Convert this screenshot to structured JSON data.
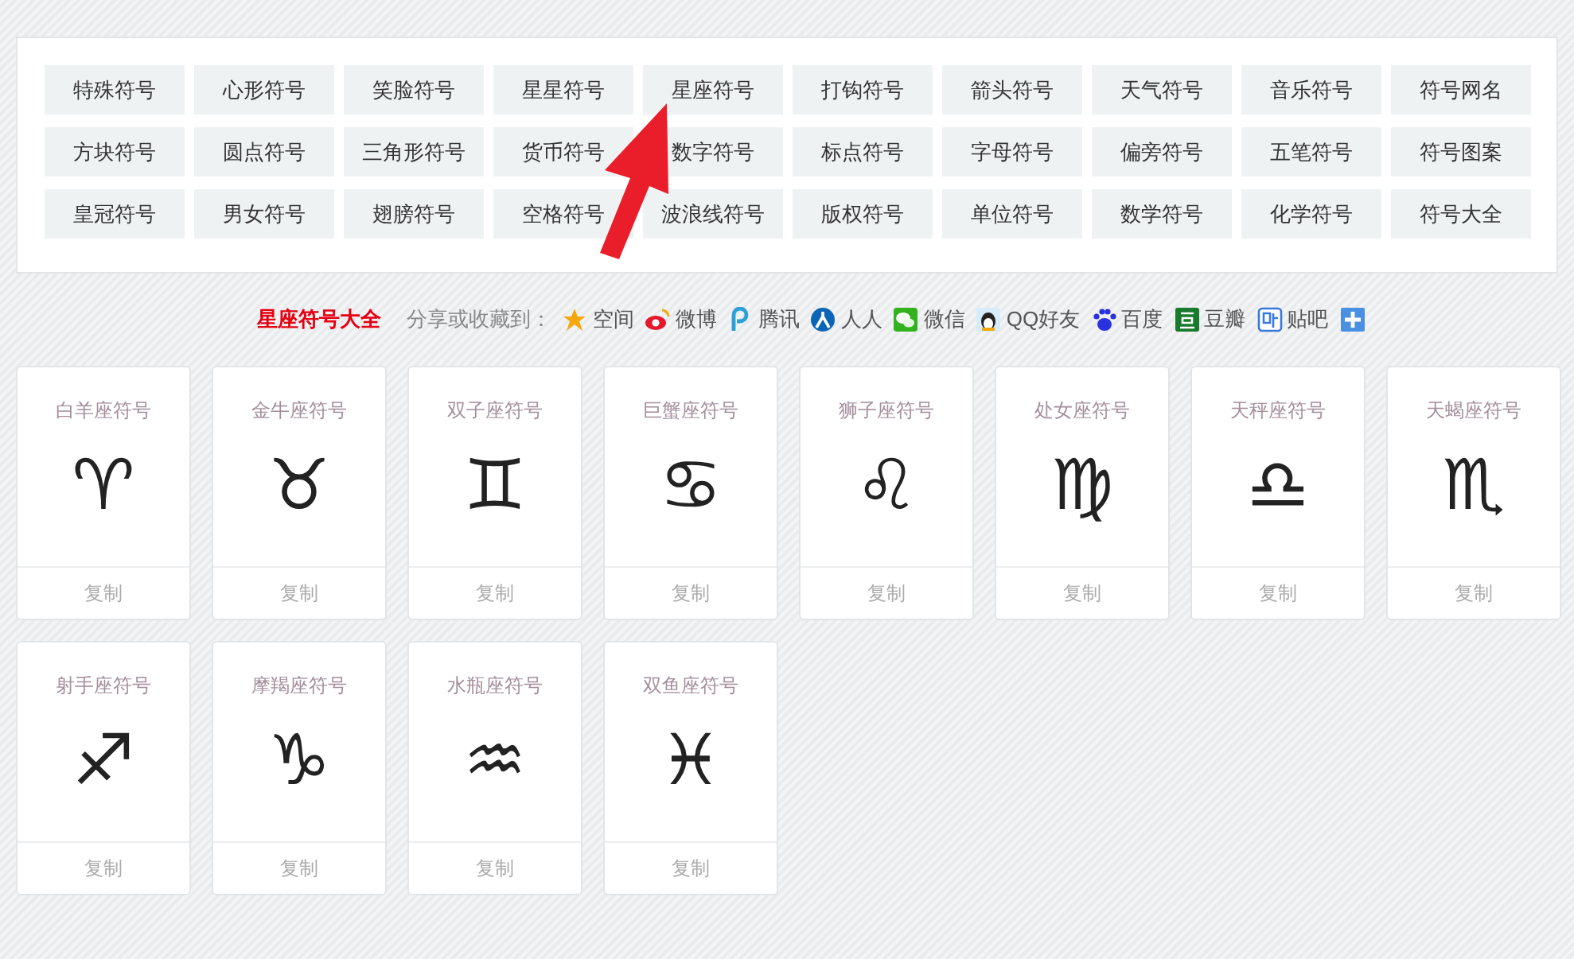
{
  "categories": [
    {
      "label": "特殊符号"
    },
    {
      "label": "心形符号"
    },
    {
      "label": "笑脸符号"
    },
    {
      "label": "星星符号"
    },
    {
      "label": "星座符号"
    },
    {
      "label": "打钩符号"
    },
    {
      "label": "箭头符号"
    },
    {
      "label": "天气符号"
    },
    {
      "label": "音乐符号"
    },
    {
      "label": "符号网名"
    },
    {
      "label": "方块符号"
    },
    {
      "label": "圆点符号"
    },
    {
      "label": "三角形符号"
    },
    {
      "label": "货币符号"
    },
    {
      "label": "数字符号"
    },
    {
      "label": "标点符号"
    },
    {
      "label": "字母符号"
    },
    {
      "label": "偏旁符号"
    },
    {
      "label": "五笔符号"
    },
    {
      "label": "符号图案"
    },
    {
      "label": "皇冠符号"
    },
    {
      "label": "男女符号"
    },
    {
      "label": "翅膀符号"
    },
    {
      "label": "空格符号"
    },
    {
      "label": "波浪线符号"
    },
    {
      "label": "版权符号"
    },
    {
      "label": "单位符号"
    },
    {
      "label": "数学符号"
    },
    {
      "label": "化学符号"
    },
    {
      "label": "符号大全"
    }
  ],
  "share": {
    "title": "星座符号大全",
    "prompt": "分享或收藏到：",
    "targets": [
      {
        "kind": "qzone",
        "label": "空间"
      },
      {
        "kind": "weibo",
        "label": "微博"
      },
      {
        "kind": "tencent",
        "label": "腾讯"
      },
      {
        "kind": "renren",
        "label": "人人"
      },
      {
        "kind": "wechat",
        "label": "微信"
      },
      {
        "kind": "qq",
        "label": "QQ好友"
      },
      {
        "kind": "baidu",
        "label": "百度"
      },
      {
        "kind": "douban",
        "label": "豆瓣"
      },
      {
        "kind": "tieba",
        "label": "贴吧"
      },
      {
        "kind": "more"
      }
    ]
  },
  "symbols": [
    {
      "name": "白羊座符号",
      "symbol": "♈",
      "action": "复制"
    },
    {
      "name": "金牛座符号",
      "symbol": "♉",
      "action": "复制"
    },
    {
      "name": "双子座符号",
      "symbol": "♊",
      "action": "复制"
    },
    {
      "name": "巨蟹座符号",
      "symbol": "♋",
      "action": "复制"
    },
    {
      "name": "狮子座符号",
      "symbol": "♌",
      "action": "复制"
    },
    {
      "name": "处女座符号",
      "symbol": "♍",
      "action": "复制"
    },
    {
      "name": "天秤座符号",
      "symbol": "♎",
      "action": "复制"
    },
    {
      "name": "天蝎座符号",
      "symbol": "♏",
      "action": "复制"
    },
    {
      "name": "射手座符号",
      "symbol": "♐",
      "action": "复制"
    },
    {
      "name": "摩羯座符号",
      "symbol": "♑",
      "action": "复制"
    },
    {
      "name": "水瓶座符号",
      "symbol": "♒",
      "action": "复制"
    },
    {
      "name": "双鱼座符号",
      "symbol": "♓",
      "action": "复制"
    }
  ]
}
